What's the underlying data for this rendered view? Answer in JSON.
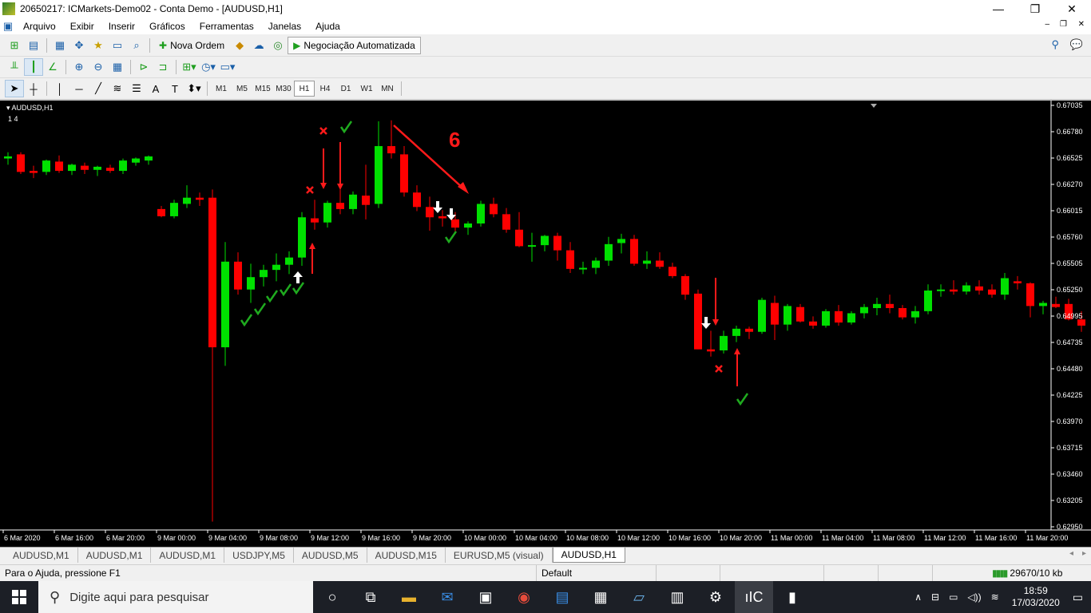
{
  "window": {
    "title": "20650217: ICMarkets-Demo02 - Conta Demo - [AUDUSD,H1]"
  },
  "menu": [
    "Arquivo",
    "Exibir",
    "Inserir",
    "Gráficos",
    "Ferramentas",
    "Janelas",
    "Ajuda"
  ],
  "toolbar": {
    "new_order": "Nova Ordem",
    "auto_trading": "Negociação Automatizada"
  },
  "timeframes": [
    "M1",
    "M5",
    "M15",
    "M30",
    "H1",
    "H4",
    "D1",
    "W1",
    "MN"
  ],
  "active_timeframe": "H1",
  "chart": {
    "symbol_label": "AUDUSD,H1",
    "sub_label": "1  4",
    "annotation_number": "6"
  },
  "chart_data": {
    "type": "candlestick",
    "symbol": "AUDUSD",
    "timeframe": "H1",
    "y_ticks": [
      "0.67035",
      "0.66780",
      "0.66525",
      "0.66270",
      "0.66015",
      "0.65760",
      "0.65505",
      "0.65250",
      "0.64995",
      "0.64735",
      "0.64480",
      "0.64225",
      "0.63970",
      "0.63715",
      "0.63460",
      "0.63205",
      "0.62950"
    ],
    "ylim": [
      0.6295,
      0.67035
    ],
    "x_ticks": [
      "6 Mar 2020",
      "6 Mar 16:00",
      "6 Mar 20:00",
      "9 Mar 00:00",
      "9 Mar 04:00",
      "9 Mar 08:00",
      "9 Mar 12:00",
      "9 Mar 16:00",
      "9 Mar 20:00",
      "10 Mar 00:00",
      "10 Mar 04:00",
      "10 Mar 08:00",
      "10 Mar 12:00",
      "10 Mar 16:00",
      "10 Mar 20:00",
      "11 Mar 00:00",
      "11 Mar 04:00",
      "11 Mar 08:00",
      "11 Mar 12:00",
      "11 Mar 16:00",
      "11 Mar 20:00"
    ],
    "bull_color": "#00e000",
    "bear_color": "#ff0000",
    "candles": [
      [
        0.6652,
        0.6658,
        0.6646,
        0.6654
      ],
      [
        0.6656,
        0.6658,
        0.6637,
        0.6639
      ],
      [
        0.664,
        0.6645,
        0.6633,
        0.6638
      ],
      [
        0.6639,
        0.6651,
        0.6636,
        0.665
      ],
      [
        0.6649,
        0.6655,
        0.6638,
        0.664
      ],
      [
        0.664,
        0.6647,
        0.6636,
        0.6646
      ],
      [
        0.6645,
        0.6648,
        0.6637,
        0.6641
      ],
      [
        0.6641,
        0.6645,
        0.6635,
        0.6644
      ],
      [
        0.6643,
        0.6646,
        0.6638,
        0.664
      ],
      [
        0.664,
        0.6652,
        0.6637,
        0.665
      ],
      [
        0.6648,
        0.6653,
        0.6645,
        0.6652
      ],
      [
        0.665,
        0.6655,
        0.6646,
        0.6654
      ],
      [
        0.6603,
        0.6606,
        0.6595,
        0.6596
      ],
      [
        0.6596,
        0.6612,
        0.6594,
        0.6609
      ],
      [
        0.6608,
        0.6626,
        0.6604,
        0.6614
      ],
      [
        0.6614,
        0.6619,
        0.6606,
        0.6612
      ],
      [
        0.6614,
        0.6622,
        0.63,
        0.6469
      ],
      [
        0.6469,
        0.6571,
        0.6451,
        0.6552
      ],
      [
        0.6552,
        0.6561,
        0.652,
        0.6525
      ],
      [
        0.6525,
        0.655,
        0.6512,
        0.6537
      ],
      [
        0.6537,
        0.6549,
        0.6528,
        0.6544
      ],
      [
        0.6544,
        0.656,
        0.6533,
        0.6549
      ],
      [
        0.6549,
        0.6562,
        0.654,
        0.6556
      ],
      [
        0.6556,
        0.66,
        0.6548,
        0.6595
      ],
      [
        0.6594,
        0.6612,
        0.6583,
        0.659
      ],
      [
        0.659,
        0.6611,
        0.6585,
        0.6609
      ],
      [
        0.6609,
        0.6622,
        0.6598,
        0.6603
      ],
      [
        0.6603,
        0.662,
        0.6598,
        0.6617
      ],
      [
        0.6616,
        0.6646,
        0.6593,
        0.6607
      ],
      [
        0.6608,
        0.6688,
        0.6604,
        0.6664
      ],
      [
        0.6664,
        0.6689,
        0.6652,
        0.6657
      ],
      [
        0.6656,
        0.6664,
        0.6615,
        0.6619
      ],
      [
        0.6619,
        0.6626,
        0.6601,
        0.6605
      ],
      [
        0.6605,
        0.6615,
        0.6582,
        0.6595
      ],
      [
        0.6596,
        0.6602,
        0.6586,
        0.6594
      ],
      [
        0.6593,
        0.66,
        0.658,
        0.6585
      ],
      [
        0.6585,
        0.6591,
        0.6578,
        0.6589
      ],
      [
        0.6589,
        0.6611,
        0.6586,
        0.6608
      ],
      [
        0.6608,
        0.6614,
        0.6595,
        0.6598
      ],
      [
        0.6598,
        0.6604,
        0.658,
        0.6583
      ],
      [
        0.6583,
        0.66,
        0.6566,
        0.6567
      ],
      [
        0.6567,
        0.658,
        0.6552,
        0.6568
      ],
      [
        0.6568,
        0.6578,
        0.6562,
        0.6577
      ],
      [
        0.6577,
        0.658,
        0.6553,
        0.6563
      ],
      [
        0.6563,
        0.6571,
        0.6541,
        0.6545
      ],
      [
        0.6545,
        0.6552,
        0.654,
        0.6546
      ],
      [
        0.6546,
        0.6556,
        0.654,
        0.6553
      ],
      [
        0.6553,
        0.6576,
        0.6548,
        0.6569
      ],
      [
        0.657,
        0.6579,
        0.656,
        0.6574
      ],
      [
        0.6574,
        0.6578,
        0.6548,
        0.655
      ],
      [
        0.655,
        0.6562,
        0.6545,
        0.6553
      ],
      [
        0.6553,
        0.6561,
        0.6545,
        0.6547
      ],
      [
        0.6547,
        0.6551,
        0.6536,
        0.6538
      ],
      [
        0.6538,
        0.654,
        0.6515,
        0.652
      ],
      [
        0.6521,
        0.6525,
        0.6467,
        0.6467
      ],
      [
        0.6467,
        0.6485,
        0.646,
        0.6465
      ],
      [
        0.6466,
        0.6485,
        0.6463,
        0.648
      ],
      [
        0.648,
        0.649,
        0.6474,
        0.6487
      ],
      [
        0.6487,
        0.6489,
        0.6477,
        0.6484
      ],
      [
        0.6484,
        0.6517,
        0.6482,
        0.6515
      ],
      [
        0.6512,
        0.6519,
        0.6476,
        0.6491
      ],
      [
        0.6491,
        0.6511,
        0.6485,
        0.6509
      ],
      [
        0.6508,
        0.6511,
        0.6493,
        0.6494
      ],
      [
        0.6494,
        0.6499,
        0.6487,
        0.649
      ],
      [
        0.649,
        0.6506,
        0.6488,
        0.6504
      ],
      [
        0.6504,
        0.651,
        0.649,
        0.6493
      ],
      [
        0.6493,
        0.6504,
        0.6491,
        0.6502
      ],
      [
        0.6502,
        0.6511,
        0.6497,
        0.6508
      ],
      [
        0.6507,
        0.6517,
        0.65,
        0.6511
      ],
      [
        0.6511,
        0.652,
        0.6502,
        0.6507
      ],
      [
        0.6507,
        0.651,
        0.6496,
        0.6498
      ],
      [
        0.6498,
        0.6509,
        0.6492,
        0.6504
      ],
      [
        0.6504,
        0.653,
        0.6501,
        0.6524
      ],
      [
        0.6524,
        0.653,
        0.6518,
        0.6525
      ],
      [
        0.6525,
        0.6534,
        0.652,
        0.6523
      ],
      [
        0.6523,
        0.6532,
        0.652,
        0.6529
      ],
      [
        0.6528,
        0.6534,
        0.652,
        0.6524
      ],
      [
        0.6525,
        0.653,
        0.6517,
        0.652
      ],
      [
        0.652,
        0.6541,
        0.6515,
        0.6536
      ],
      [
        0.6533,
        0.6538,
        0.6525,
        0.6531
      ],
      [
        0.6531,
        0.6532,
        0.6498,
        0.6509
      ],
      [
        0.6509,
        0.6514,
        0.6501,
        0.6512
      ],
      [
        0.6511,
        0.6518,
        0.6507,
        0.6508
      ],
      [
        0.6511,
        0.6516,
        0.6495,
        0.6496
      ],
      [
        0.6496,
        0.6504,
        0.6484,
        0.649
      ]
    ]
  },
  "tabs": [
    "AUDUSD,M1",
    "AUDUSD,M1",
    "AUDUSD,M1",
    "USDJPY,M5",
    "AUDUSD,M5",
    "AUDUSD,M15",
    "EURUSD,M5 (visual)",
    "AUDUSD,H1"
  ],
  "active_tab": "AUDUSD,H1",
  "status": {
    "help": "Para o Ajuda, pressione F1",
    "profile": "Default",
    "traffic": "29670/10 kb"
  },
  "taskbar": {
    "search_placeholder": "Digite aqui para pesquisar",
    "time": "18:59",
    "date": "17/03/2020"
  }
}
